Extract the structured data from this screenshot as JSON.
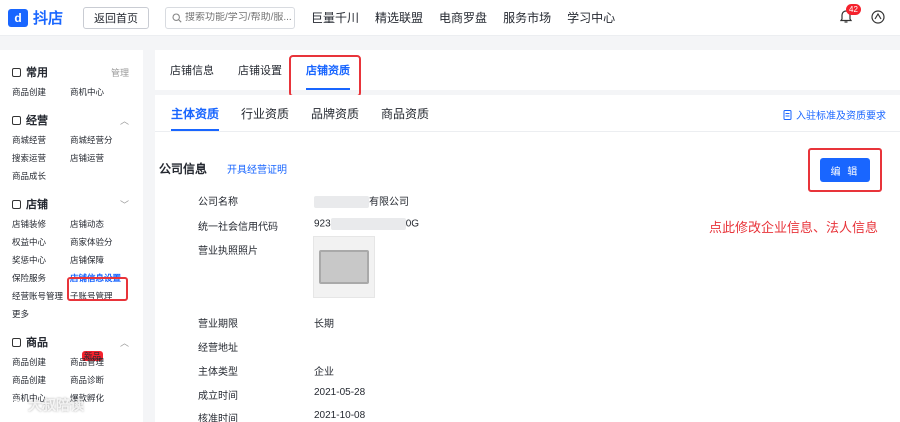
{
  "topbar": {
    "logo_text": "抖店",
    "home_button": "返回首页",
    "search_placeholder": "搜索功能/学习/帮助/服...",
    "nav": [
      "巨量千川",
      "精选联盟",
      "电商罗盘",
      "服务市场",
      "学习中心"
    ],
    "notification_count": "42"
  },
  "sidebar": {
    "groups": [
      {
        "title": "常用",
        "right": "管理",
        "items": [
          "商品创建",
          "商机中心"
        ]
      },
      {
        "title": "经营",
        "right": "^",
        "items": [
          "商城经营",
          "商城经营分",
          "搜索运营",
          "店铺运营",
          "商品成长"
        ]
      },
      {
        "title": "店铺",
        "right": "v",
        "items": [
          "店铺装修",
          "店铺动态",
          "权益中心",
          "商家体验分",
          "奖惩中心",
          "店铺保障",
          "保险服务",
          "店铺信息设置",
          "经营账号管理",
          "子账号管理",
          "更多"
        ]
      },
      {
        "title": "商品",
        "right": "^",
        "items": [
          "商品创建",
          "商品管理",
          "商品创建",
          "商品诊断",
          "商机中心",
          "爆款孵化"
        ]
      }
    ],
    "new_tag": "新品",
    "active_item": "店铺信息设置"
  },
  "tabs_top": [
    "店铺信息",
    "店铺设置",
    "店铺资质"
  ],
  "tabs_sub": [
    "主体资质",
    "行业资质",
    "品牌资质",
    "商品资质"
  ],
  "requirement_link": "入驻标准及资质要求",
  "company": {
    "title": "公司信息",
    "cert_link": "开具经营证明",
    "edit_button": "编 辑",
    "annotation": "点此修改企业信息、法人信息",
    "fields": [
      {
        "label": "公司名称",
        "value": "有限公司"
      },
      {
        "label": "统一社会信用代码",
        "value_prefix": "923",
        "value_suffix": "0G"
      },
      {
        "label": "营业执照照片",
        "value": ""
      },
      {
        "label": "营业期限",
        "value": "长期"
      },
      {
        "label": "经营地址",
        "value": ""
      },
      {
        "label": "主体类型",
        "value": "企业"
      },
      {
        "label": "成立时间",
        "value": "2021-05-28"
      },
      {
        "label": "核准时间",
        "value": "2021-10-08"
      }
    ]
  },
  "watermark": "大叔陪读"
}
